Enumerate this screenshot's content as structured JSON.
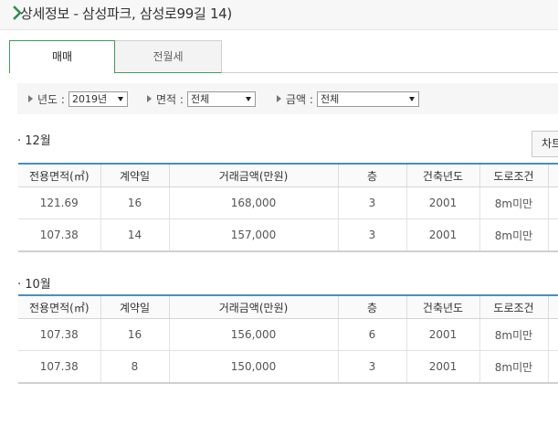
{
  "header": {
    "title": "상세정보 - 삼성파크, 삼성로99길 14)",
    "accent_color": "#2f8f4e"
  },
  "tabs": [
    {
      "label": "매매",
      "active": true
    },
    {
      "label": "전월세",
      "active": false
    }
  ],
  "filters": {
    "year": {
      "label": "년도 :",
      "value": "2019년"
    },
    "area": {
      "label": "면적 :",
      "value": "전체"
    },
    "price": {
      "label": "금액 :",
      "value": "전체"
    }
  },
  "chart_button_label": "차트",
  "table_headers": [
    "전용면적(㎡)",
    "계약일",
    "거래금액(만원)",
    "층",
    "건축년도",
    "도로조건"
  ],
  "sections": [
    {
      "title": "· 12월",
      "rows": [
        {
          "area": "121.69",
          "day": "16",
          "price": "168,000",
          "floor": "3",
          "built": "2001",
          "road": "8m미만"
        },
        {
          "area": "107.38",
          "day": "14",
          "price": "157,000",
          "floor": "3",
          "built": "2001",
          "road": "8m미만"
        }
      ]
    },
    {
      "title": "· 10월",
      "rows": [
        {
          "area": "107.38",
          "day": "16",
          "price": "156,000",
          "floor": "6",
          "built": "2001",
          "road": "8m미만"
        },
        {
          "area": "107.38",
          "day": "8",
          "price": "150,000",
          "floor": "3",
          "built": "2001",
          "road": "8m미만"
        }
      ]
    }
  ]
}
